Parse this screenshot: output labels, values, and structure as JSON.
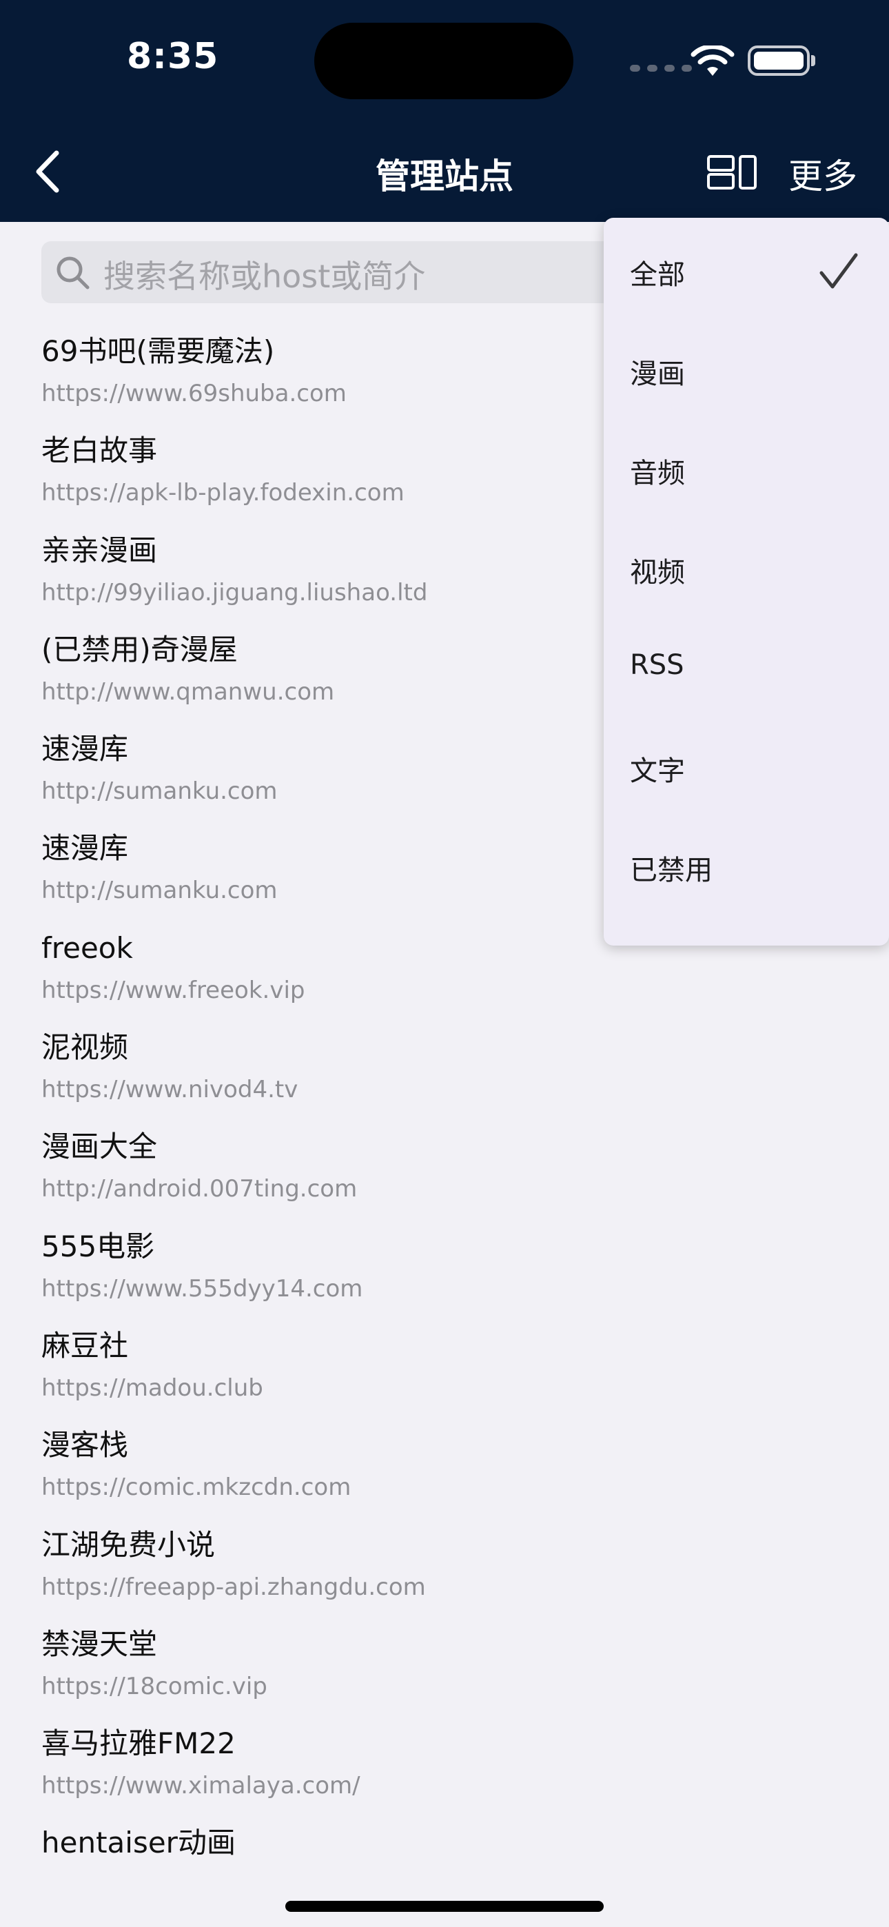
{
  "status_bar": {
    "time": "8:35"
  },
  "nav": {
    "title": "管理站点",
    "more_label": "更多"
  },
  "search": {
    "placeholder": "搜索名称或host或简介"
  },
  "sites": [
    {
      "name": "69书吧(需要魔法)",
      "url": "https://www.69shuba.com"
    },
    {
      "name": "老白故事",
      "url": "https://apk-lb-play.fodexin.com"
    },
    {
      "name": "亲亲漫画",
      "url": "http://99yiliao.jiguang.liushao.ltd"
    },
    {
      "name": "(已禁用)奇漫屋",
      "url": "http://www.qmanwu.com"
    },
    {
      "name": "速漫库",
      "url": "http://sumanku.com"
    },
    {
      "name": "速漫库",
      "url": "http://sumanku.com"
    },
    {
      "name": "freeok",
      "url": "https://www.freeok.vip"
    },
    {
      "name": "泥视频",
      "url": "https://www.nivod4.tv"
    },
    {
      "name": "漫画大全",
      "url": "http://android.007ting.com"
    },
    {
      "name": "555电影",
      "url": "https://www.555dyy14.com"
    },
    {
      "name": "麻豆社",
      "url": "https://madou.club"
    },
    {
      "name": "漫客栈",
      "url": "https://comic.mkzcdn.com"
    },
    {
      "name": "江湖免费小说",
      "url": "https://freeapp-api.zhangdu.com"
    },
    {
      "name": "禁漫天堂",
      "url": "https://18comic.vip"
    },
    {
      "name": "喜马拉雅FM22",
      "url": "https://www.ximalaya.com/"
    },
    {
      "name": "hentaiser动画",
      "url": ""
    }
  ],
  "filter_menu": {
    "selected": "全部",
    "items": [
      "全部",
      "漫画",
      "音频",
      "视频",
      "RSS",
      "文字",
      "已禁用"
    ]
  },
  "colors": {
    "header_bg": "#061a36",
    "page_bg": "#f2f1f6",
    "menu_bg": "#efecf7",
    "url_gray": "#8e8e93"
  }
}
